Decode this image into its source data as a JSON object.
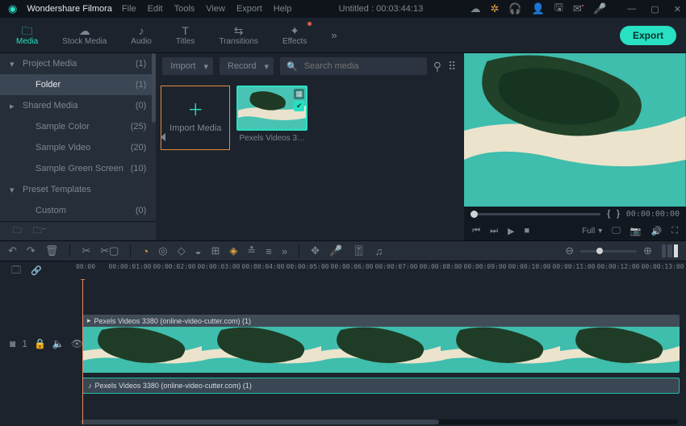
{
  "app": {
    "name": "Wondershare Filmora"
  },
  "menus": [
    "File",
    "Edit",
    "Tools",
    "View",
    "Export",
    "Help"
  ],
  "title_center": "Untitled : 00:03:44:13",
  "tabs": [
    {
      "icon": "🗀",
      "label": "Media",
      "active": true
    },
    {
      "icon": "☁",
      "label": "Stock Media"
    },
    {
      "icon": "♪",
      "label": "Audio"
    },
    {
      "icon": "T",
      "label": "Titles"
    },
    {
      "icon": "⇆",
      "label": "Transitions"
    },
    {
      "icon": "✦",
      "label": "Effects",
      "dot": true
    }
  ],
  "export_label": "Export",
  "sidebar": [
    {
      "indent": 0,
      "caret": "▾",
      "label": "Project Media",
      "count": "(1)"
    },
    {
      "indent": 1,
      "caret": "",
      "label": "Folder",
      "count": "(1)",
      "sel": true
    },
    {
      "indent": 0,
      "caret": "▸",
      "label": "Shared Media",
      "count": "(0)"
    },
    {
      "indent": 1,
      "caret": "",
      "label": "Sample Color",
      "count": "(25)"
    },
    {
      "indent": 1,
      "caret": "",
      "label": "Sample Video",
      "count": "(20)"
    },
    {
      "indent": 1,
      "caret": "",
      "label": "Sample Green Screen",
      "count": "(10)"
    },
    {
      "indent": 0,
      "caret": "▾",
      "label": "Preset Templates",
      "count": ""
    },
    {
      "indent": 1,
      "caret": "",
      "label": "Custom",
      "count": "(0)"
    }
  ],
  "media_tools": {
    "import": "Import",
    "record": "Record",
    "search_ph": "Search media"
  },
  "import_card": "Import Media",
  "media_item": {
    "caption": "Pexels Videos 3…"
  },
  "preview": {
    "brace_l": "{",
    "brace_r": "}",
    "time": "00:00:00:00",
    "full": "Full"
  },
  "ruler": [
    "00:00",
    "00:00:01:00",
    "00:00:02:00",
    "00:00:03:00",
    "00:00:04:00",
    "00:00:05:00",
    "00:00:06:00",
    "00:00:07:00",
    "00:00:08:00",
    "00:00:09:00",
    "00:00:10:00",
    "00:00:11:00",
    "00:00:12:00",
    "00:00:13:00"
  ],
  "track": {
    "video_label": "Pexels Videos 3380 (online-video-cutter.com) (1)",
    "audio_label": "Pexels Videos 3380 (online-video-cutter.com) (1)",
    "track_id": "1"
  }
}
